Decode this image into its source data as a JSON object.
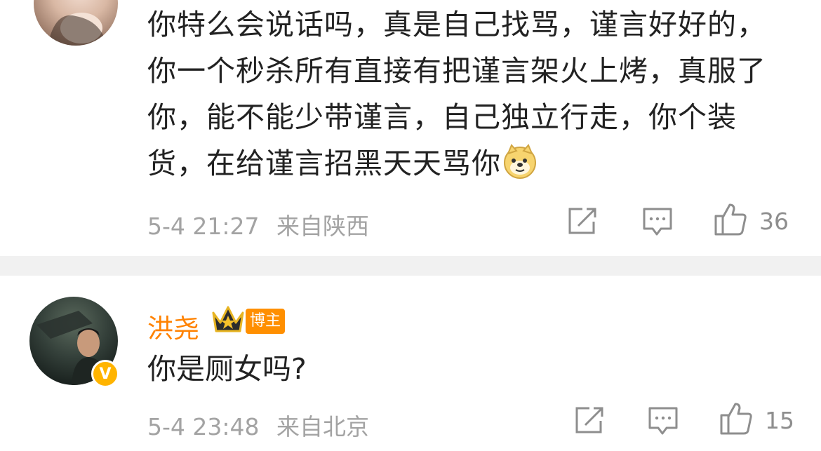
{
  "comments": [
    {
      "text": "你特么会说话吗，真是自己找骂，谨言好好的，你一个秒杀所有直接有把谨言架火上烤，真服了你，能不能少带谨言，自己独立行走，你个装货，在给谨言招黑天天骂你",
      "emoji": "doge-emoji",
      "time": "5-4 21:27",
      "location": "来自陕西",
      "likes": "36"
    },
    {
      "author": "洪尧",
      "author_badge": "博主",
      "verified_mark": "V",
      "text": "你是厕女吗?",
      "time": "5-4 23:48",
      "location": "来自北京",
      "likes": "15"
    }
  ],
  "colors": {
    "author_name": "#ff8200",
    "meta_text": "#a3a3a3",
    "divider": "#f1f1f1",
    "verified_badge": "#ffb400"
  },
  "icons": [
    "share-icon",
    "comment-icon",
    "like-icon",
    "crown-icon",
    "doge-emoji"
  ]
}
